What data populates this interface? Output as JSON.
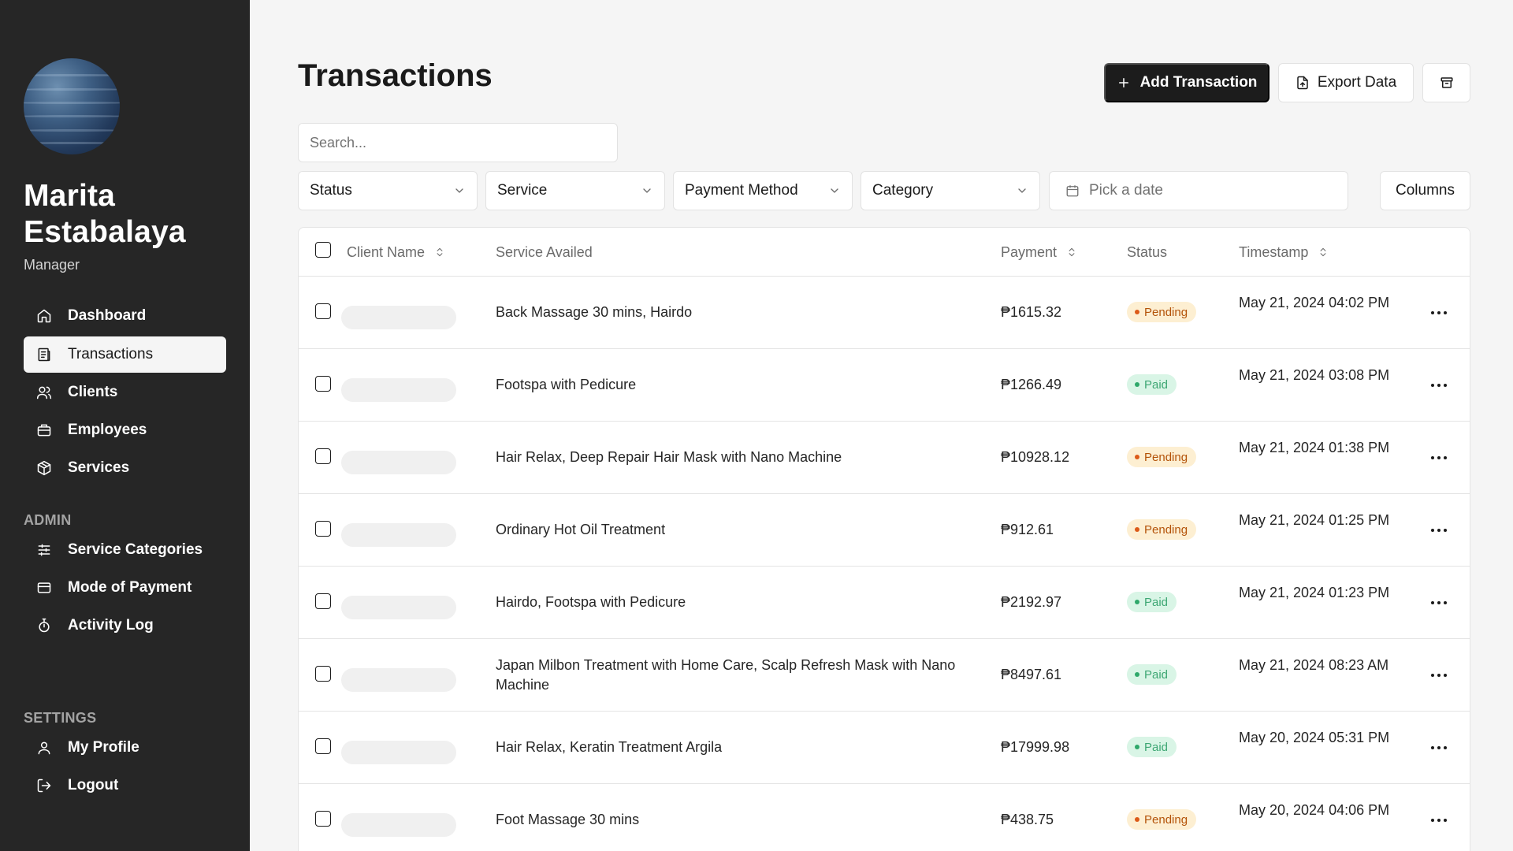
{
  "sidebar": {
    "user": {
      "name": "Marita Estabalaya",
      "role": "Manager"
    },
    "nav": [
      {
        "label": "Dashboard",
        "icon": "home-icon"
      },
      {
        "label": "Transactions",
        "icon": "receipt-icon",
        "active": true
      },
      {
        "label": "Clients",
        "icon": "users-icon"
      },
      {
        "label": "Employees",
        "icon": "briefcase-icon"
      },
      {
        "label": "Services",
        "icon": "package-icon"
      }
    ],
    "admin_label": "ADMIN",
    "admin": [
      {
        "label": "Service Categories",
        "icon": "sliders-icon"
      },
      {
        "label": "Mode of Payment",
        "icon": "credit-card-icon"
      },
      {
        "label": "Activity Log",
        "icon": "timer-icon"
      }
    ],
    "settings_label": "SETTINGS",
    "settings": [
      {
        "label": "My Profile",
        "icon": "user-icon"
      },
      {
        "label": "Logout",
        "icon": "logout-icon"
      }
    ]
  },
  "header": {
    "title": "Transactions",
    "add_label": "Add Transaction",
    "export_label": "Export Data"
  },
  "search": {
    "placeholder": "Search..."
  },
  "filters": {
    "status": "Status",
    "service": "Service",
    "payment_method": "Payment Method",
    "category": "Category",
    "date_placeholder": "Pick a date",
    "columns_label": "Columns"
  },
  "table": {
    "columns": {
      "client": "Client Name",
      "service": "Service Availed",
      "payment": "Payment",
      "status": "Status",
      "timestamp": "Timestamp"
    },
    "rows": [
      {
        "service": "Back Massage 30 mins, Hairdo",
        "payment": "₱1615.32",
        "status": "Pending",
        "status_type": "pending",
        "timestamp": "May 21, 2024 04:02 PM"
      },
      {
        "service": "Footspa with Pedicure",
        "payment": "₱1266.49",
        "status": "Paid",
        "status_type": "paid",
        "timestamp": "May 21, 2024 03:08 PM"
      },
      {
        "service": "Hair Relax, Deep Repair Hair Mask with Nano Machine",
        "payment": "₱10928.12",
        "status": "Pending",
        "status_type": "pending",
        "timestamp": "May 21, 2024 01:38 PM"
      },
      {
        "service": "Ordinary Hot Oil Treatment",
        "payment": "₱912.61",
        "status": "Pending",
        "status_type": "pending",
        "timestamp": "May 21, 2024 01:25 PM"
      },
      {
        "service": "Hairdo, Footspa with Pedicure",
        "payment": "₱2192.97",
        "status": "Paid",
        "status_type": "paid",
        "timestamp": "May 21, 2024 01:23 PM"
      },
      {
        "service": "Japan Milbon Treatment with Home Care, Scalp Refresh Mask with Nano Machine",
        "payment": "₱8497.61",
        "status": "Paid",
        "status_type": "paid",
        "timestamp": "May 21, 2024 08:23 AM"
      },
      {
        "service": "Hair Relax, Keratin Treatment Argila",
        "payment": "₱17999.98",
        "status": "Paid",
        "status_type": "paid",
        "timestamp": "May 20, 2024 05:31 PM"
      },
      {
        "service": "Foot Massage 30 mins",
        "payment": "₱438.75",
        "status": "Pending",
        "status_type": "pending",
        "timestamp": "May 20, 2024 04:06 PM"
      }
    ]
  }
}
